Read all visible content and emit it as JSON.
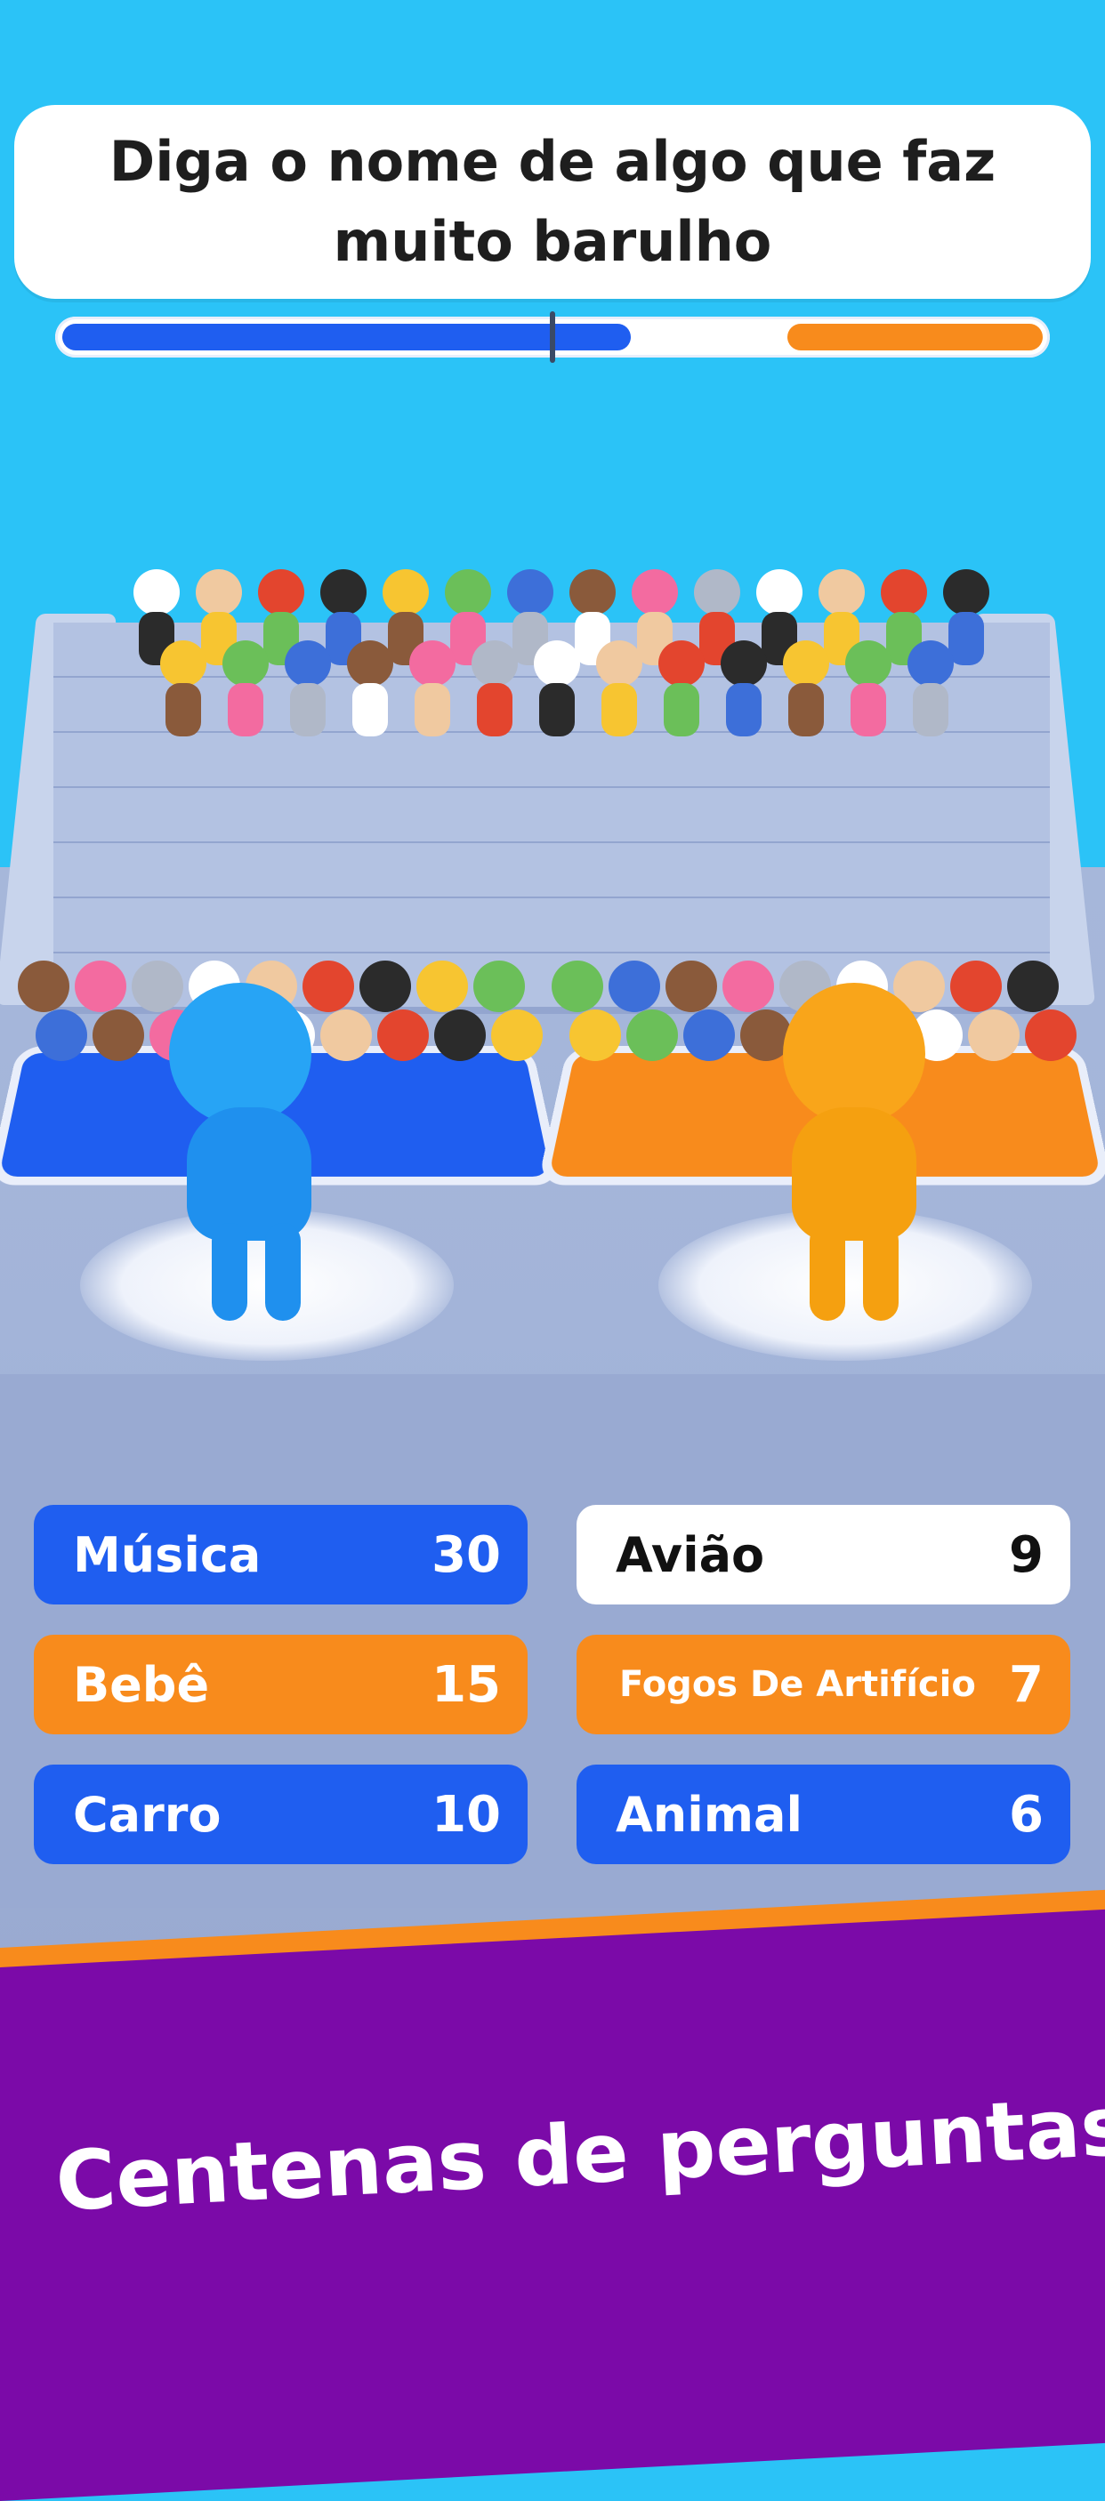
{
  "question": {
    "line1": "Diga o nome de algo que faz",
    "line2": "muito barulho"
  },
  "progress": {
    "blue_fraction": 0.58,
    "orange_fraction": 0.26,
    "marker_fraction": 0.5
  },
  "colors": {
    "sky": "#2bc3f7",
    "blue_team": "#1f5ef0",
    "orange_team": "#f88b1c",
    "banner": "#7b0aa8"
  },
  "answers": [
    {
      "label": "Música",
      "score": "30",
      "color": "blue"
    },
    {
      "label": "Avião",
      "score": "9",
      "color": "white"
    },
    {
      "label": "Bebê",
      "score": "15",
      "color": "orange"
    },
    {
      "label": "Fogos De Artifício",
      "score": "7",
      "color": "orange"
    },
    {
      "label": "Carro",
      "score": "10",
      "color": "blue"
    },
    {
      "label": "Animal",
      "score": "6",
      "color": "blue"
    }
  ],
  "banner": {
    "text": "Centenas de perguntas"
  }
}
